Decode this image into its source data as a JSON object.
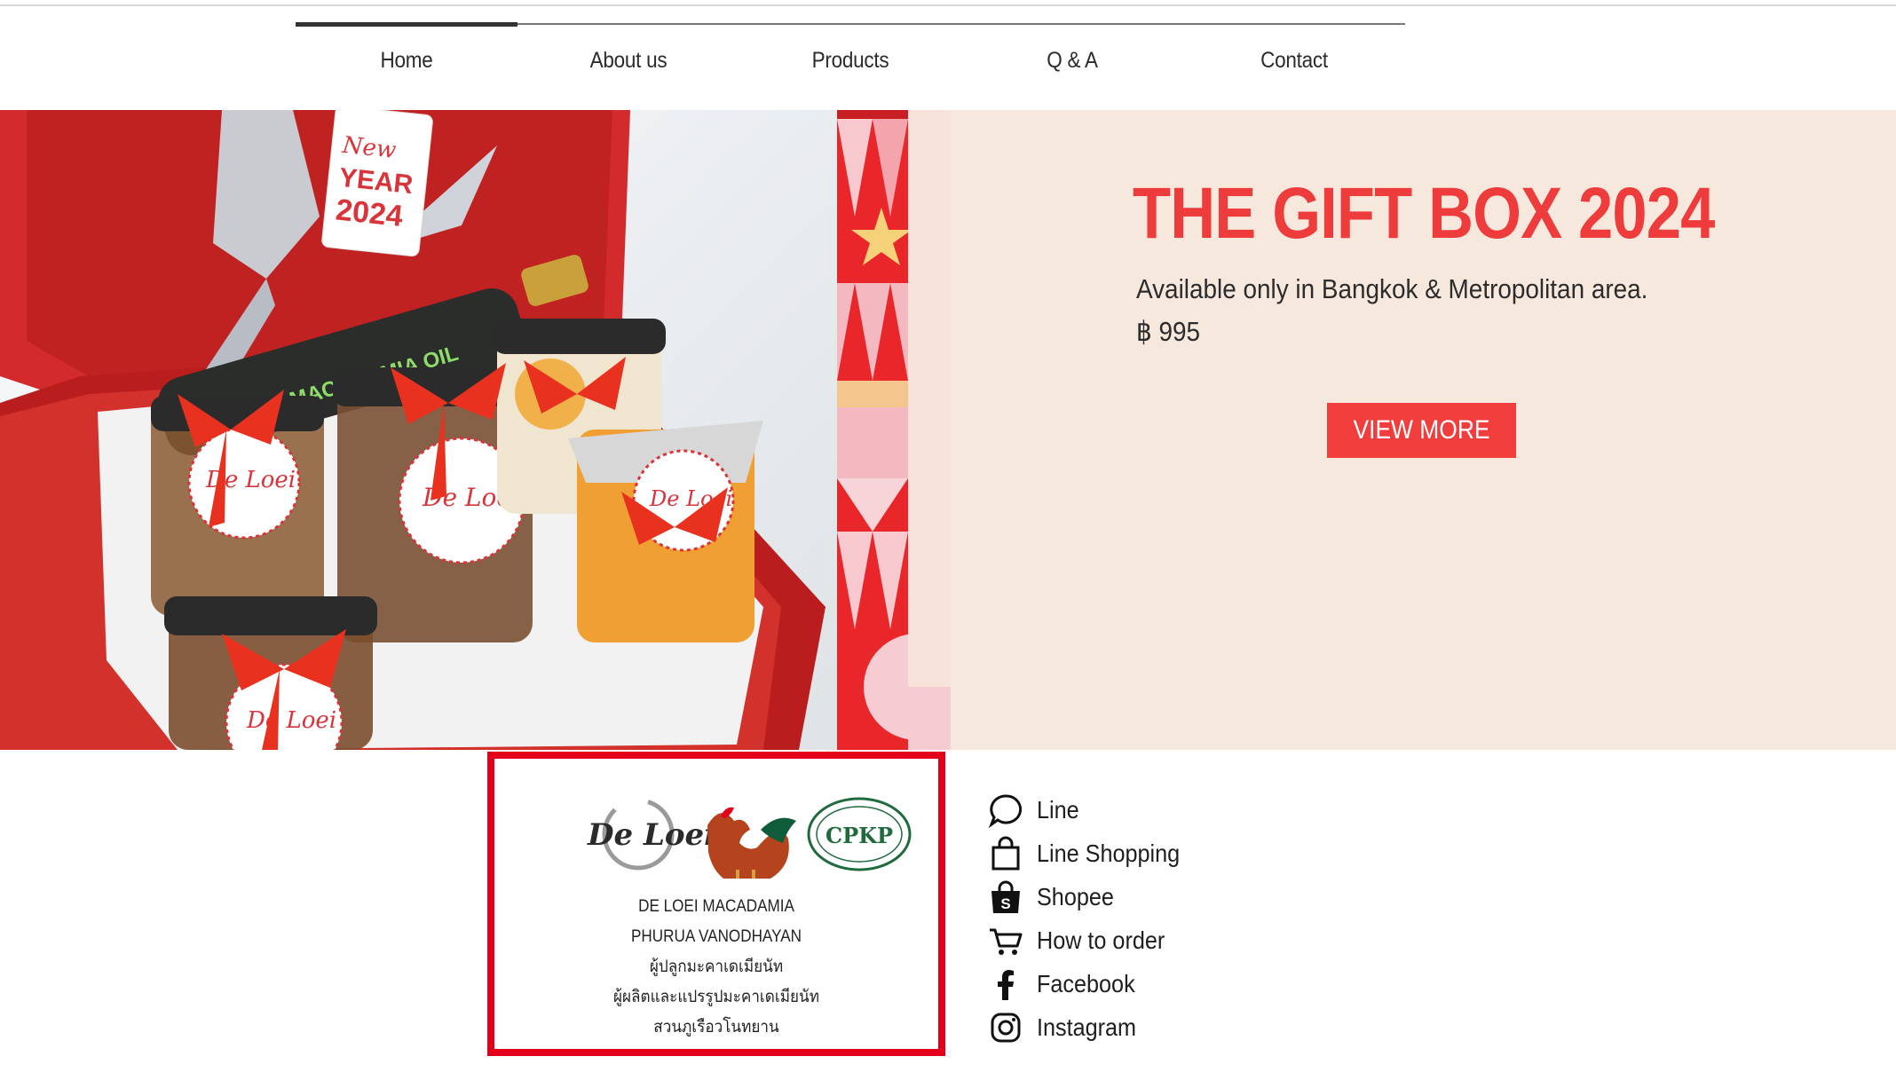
{
  "nav": {
    "items": [
      {
        "label": "Home",
        "active": true
      },
      {
        "label": "About us"
      },
      {
        "label": "Products"
      },
      {
        "label": "Q & A"
      },
      {
        "label": "Contact"
      }
    ]
  },
  "hero": {
    "title": "THE GIFT BOX 2024",
    "subtitle": "Available only in Bangkok & Metropolitan area.",
    "price": "฿ 995",
    "button_label": "VIEW MORE",
    "accent_color": "#ee3b3b",
    "background_color": "#f7e8de",
    "photo": {
      "tag_line1": "New",
      "tag_line2": "YEAR",
      "tag_line3": "2024",
      "jar_label": "De Loei",
      "bottle_label": "MACADAMIA OIL"
    }
  },
  "brand": {
    "logos": {
      "deloei": "De Loei",
      "cpkp": "CPKP"
    },
    "lines": [
      "DE LOEI MACADAMIA",
      "PHURUA VANODHAYAN",
      "ผู้ปลูกมะคาเดเมียนัท",
      "ผู้ผลิตและแปรรูปมะคาเดเมียนัท",
      "สวนภูเรือวโนทยาน"
    ],
    "border_color": "#e3001b"
  },
  "social": [
    {
      "label": "Line",
      "icon": "chat-bubble-icon"
    },
    {
      "label": "Line Shopping",
      "icon": "shopping-bag-icon"
    },
    {
      "label": "Shopee",
      "icon": "shopee-bag-icon"
    },
    {
      "label": "How to order",
      "icon": "cart-icon"
    },
    {
      "label": "Facebook",
      "icon": "facebook-icon"
    },
    {
      "label": "Instagram",
      "icon": "instagram-icon"
    }
  ]
}
